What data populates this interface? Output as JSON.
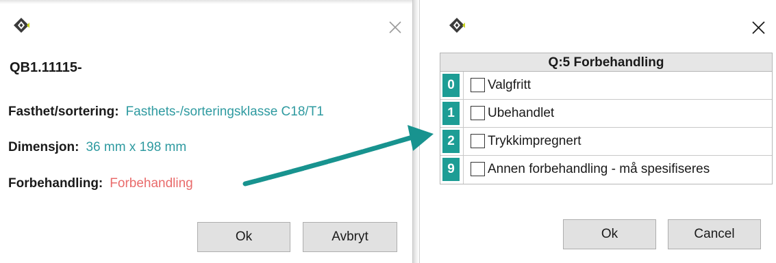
{
  "left_dialog": {
    "record_title": "QB1.11115-",
    "fields": [
      {
        "label": "Fasthet/sortering:",
        "value": "Fasthets-/sorteringsklasse C18/T1"
      },
      {
        "label": "Dimensjon:",
        "value": "36 mm x 198 mm"
      },
      {
        "label": "Forbehandling:",
        "value": "Forbehandling"
      }
    ],
    "ok_label": "Ok",
    "cancel_label": "Avbryt"
  },
  "right_dialog": {
    "table_title": "Q:5 Forbehandling",
    "options": [
      {
        "code": "0",
        "label": "Valgfritt",
        "checked": false
      },
      {
        "code": "1",
        "label": "Ubehandlet",
        "checked": false
      },
      {
        "code": "2",
        "label": "Trykkimpregnert",
        "checked": false
      },
      {
        "code": "9",
        "label": "Annen forbehandling - må spesifiseres",
        "checked": false
      }
    ],
    "ok_label": "Ok",
    "cancel_label": "Cancel"
  },
  "icons": {
    "app": "app-logo-icon",
    "close": "close-icon",
    "arrow": "annotation-arrow"
  },
  "colors": {
    "teal_value": "#2e9aa0",
    "red_value": "#e96b6b",
    "code_badge": "#1d9d95",
    "arrow": "#18938f"
  }
}
